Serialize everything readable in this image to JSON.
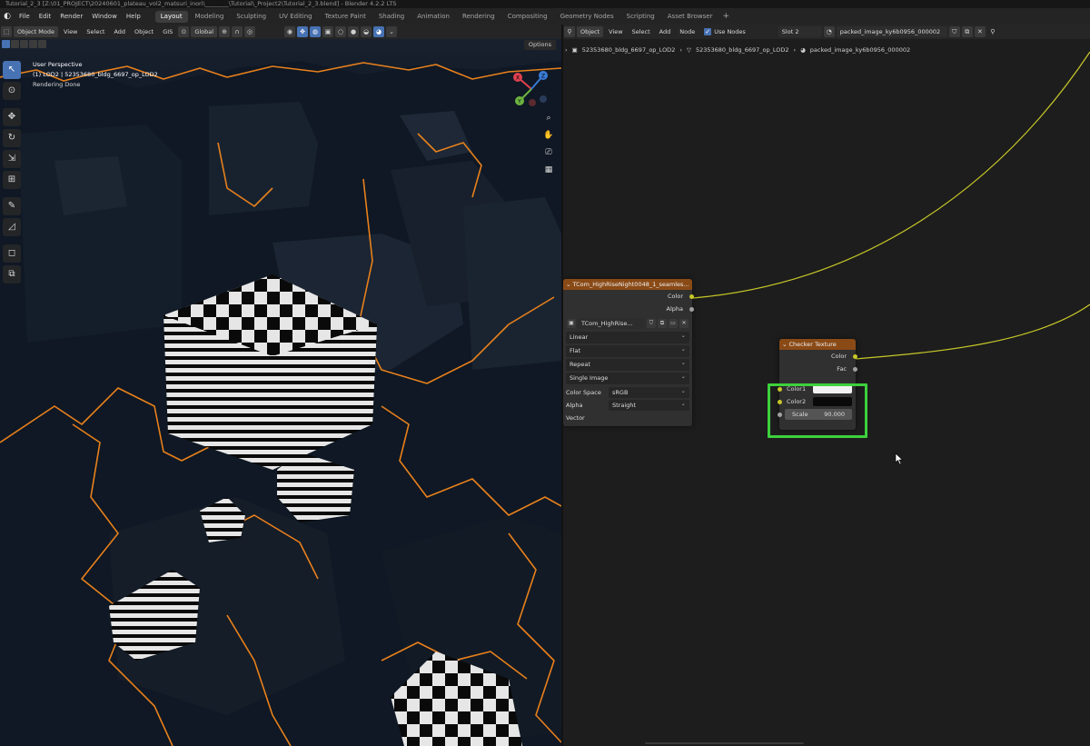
{
  "window": {
    "title": "Tutorial_2_3 [Z:\\01_PROJECT\\20240601_plateau_vol2_matsuri_inori\\________\\Tutorial\\_Project2\\Tutorial_2_3.blend] - Blender 4.2.2 LTS"
  },
  "menu": [
    "File",
    "Edit",
    "Render",
    "Window",
    "Help"
  ],
  "workspaces": [
    "Layout",
    "Modeling",
    "Sculpting",
    "UV Editing",
    "Texture Paint",
    "Shading",
    "Animation",
    "Rendering",
    "Compositing",
    "Geometry Nodes",
    "Scripting",
    "Asset Browser"
  ],
  "workspace_add": "+",
  "viewport": {
    "mode": "Object Mode",
    "menus": [
      "View",
      "Select",
      "Add",
      "Object",
      "GIS"
    ],
    "transform_orientation": "Global",
    "options": "Options",
    "info_line1": "User Perspective",
    "info_line2": "(1) LOD2 | 52353680_bldg_6697_op_LOD2",
    "info_line3": "Rendering Done",
    "gizmo_axes": [
      "X",
      "Y",
      "Z"
    ]
  },
  "node_editor": {
    "type": "Object",
    "menus": [
      "View",
      "Select",
      "Add",
      "Node"
    ],
    "use_nodes_label": "Use Nodes",
    "slot": "Slot 2",
    "material": "packed_image_ky6b0956_000002",
    "breadcrumb": [
      "52353680_bldg_6697_op_LOD2",
      "52353680_bldg_6697_op_LOD2",
      "packed_image_ky6b0956_000002"
    ]
  },
  "image_node": {
    "title": "TCom_HighRiseNight0048_1_seamles...",
    "out_color": "Color",
    "out_alpha": "Alpha",
    "image_name": "TCom_HighRise...",
    "interpolation": "Linear",
    "projection": "Flat",
    "extension": "Repeat",
    "source": "Single Image",
    "color_space_label": "Color Space",
    "color_space": "sRGB",
    "alpha_label": "Alpha",
    "alpha_mode": "Straight",
    "vector_label": "Vector"
  },
  "checker_node": {
    "title": "Checker Texture",
    "out_color": "Color",
    "out_fac": "Fac",
    "color1_label": "Color1",
    "color2_label": "Color2",
    "scale_label": "Scale",
    "scale_value": "90.000",
    "color1": "#f2f2f2",
    "color2": "#0a0a0a"
  },
  "colors": {
    "accent": "#4772b3",
    "selection_outline": "#e8801c",
    "texture_node_header": "#8a4a16",
    "link": "#c7c729",
    "highlight_box": "#3dd13d"
  }
}
